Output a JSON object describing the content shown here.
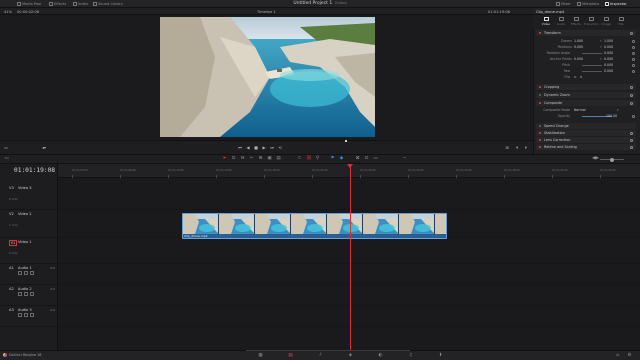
{
  "topbar": {
    "items": [
      "Media Pool",
      "Effects",
      "Index",
      "Sound Library"
    ],
    "title": "Untitled Project 1",
    "title_sub": "Edited",
    "right_items": [
      "Mixer",
      "Metadata",
      "Inspector"
    ]
  },
  "viewer": {
    "zoom": "41%",
    "source_tc": "00:00:02:08",
    "timeline_name": "Timeline 1",
    "record_tc": "01:01:19:08"
  },
  "inspector": {
    "clip_name": "Clip_drone.mp4",
    "tabs": [
      "Video",
      "Audio",
      "Effects",
      "Transition",
      "Image",
      "File"
    ],
    "sections_top": [
      {
        "label": "Transform"
      }
    ],
    "transform": [
      {
        "label": "Zoom",
        "tag": "X",
        "v1": "1.000",
        "tag2": "Y",
        "v2": "1.000"
      },
      {
        "label": "Position",
        "tag": "X",
        "v1": "0.000",
        "tag2": "Y",
        "v2": "0.000"
      },
      {
        "label": "Rotation Angle",
        "v1": "",
        "v2": "0.000"
      },
      {
        "label": "Anchor Point",
        "tag": "X",
        "v1": "0.000",
        "tag2": "Y",
        "v2": "0.000"
      },
      {
        "label": "Pitch",
        "v1": "",
        "v2": "0.000"
      },
      {
        "label": "Yaw",
        "v1": "",
        "v2": "0.000"
      },
      {
        "label": "Flip",
        "v1": "",
        "v2": ""
      }
    ],
    "sections_mid": [
      {
        "label": "Cropping"
      },
      {
        "label": "Dynamic Zoom"
      },
      {
        "label": "Composite"
      }
    ],
    "composite": [
      {
        "label": "Composite Mode",
        "v1": "Normal"
      },
      {
        "label": "Opacity",
        "v2": "100.00"
      }
    ],
    "sections_bottom": [
      {
        "label": "Speed Change"
      },
      {
        "label": "Stabilization"
      },
      {
        "label": "Lens Correction"
      },
      {
        "label": "Retime and Scaling"
      }
    ]
  },
  "timeline": {
    "timecode": "01:01:19:08",
    "ruler": [
      "01:01:02:00",
      "01:01:06:00",
      "01:01:10:00",
      "01:01:14:00",
      "01:01:18:00",
      "01:01:22:00",
      "01:01:26:00",
      "01:01:30:00",
      "01:01:34:00",
      "01:01:38:00",
      "01:01:42:00",
      "01:01:46:00"
    ],
    "video_tracks": [
      {
        "id": "V3",
        "name": "Video 3",
        "sub": "0 Clip"
      },
      {
        "id": "V2",
        "name": "Video 2",
        "sub": "1 Clip"
      },
      {
        "id": "V1",
        "name": "Video 1",
        "sub": "0 Clip"
      }
    ],
    "audio_tracks": [
      {
        "id": "A1",
        "name": "Audio 1",
        "value": "2.0"
      },
      {
        "id": "A2",
        "name": "Audio 2",
        "value": "2.0"
      },
      {
        "id": "A3",
        "name": "Audio 3",
        "value": "2.0"
      }
    ],
    "clip_label": "Clip_drone.mp4"
  },
  "bottombar": {
    "app_name": "DaVinci Resolve 18",
    "pages": [
      "media-page-icon",
      "cut-page-icon",
      "edit-page-icon",
      "fusion-page-icon",
      "color-page-icon",
      "fairlight-page-icon",
      "deliver-page-icon"
    ]
  },
  "colors": {
    "accent": "#e02d3a",
    "clip": "#2a5f94",
    "background": "#1b1b1d"
  }
}
